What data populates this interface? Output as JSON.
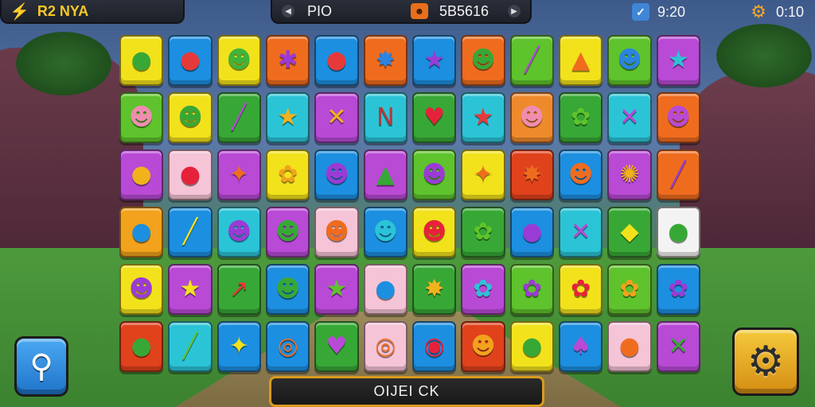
{
  "hud": {
    "left_label": "R2 NYA",
    "center_label": "PIO",
    "center_value": "5B5616",
    "timer_1": "9:20",
    "timer_2": "0:10"
  },
  "icons": {
    "bolt": "lightning-icon",
    "arrow": "arrow-left-icon",
    "tile_badge": "face-tile-icon",
    "check": "check-icon",
    "settings": "gear-icon",
    "hint": "magnifier-icon",
    "pause": "gear-icon"
  },
  "board": {
    "rows": [
      [
        {
          "color": "#f2e21c",
          "sym": "●",
          "fg": "#37a836"
        },
        {
          "color": "#1c8fe0",
          "sym": "●",
          "fg": "#e63a3a"
        },
        {
          "color": "#f2e21c",
          "sym": "☻",
          "fg": "#3fb33a"
        },
        {
          "color": "#ef6c1f",
          "sym": "✱",
          "fg": "#9b3bd6"
        },
        {
          "color": "#1c8fe0",
          "sym": "●",
          "fg": "#e63a3a"
        },
        {
          "color": "#ef6c1f",
          "sym": "✸",
          "fg": "#2b84e0"
        },
        {
          "color": "#1c8fe0",
          "sym": "★",
          "fg": "#9b3bd6"
        },
        {
          "color": "#ef6c1f",
          "sym": "☻",
          "fg": "#37a836"
        },
        {
          "color": "#5ec32c",
          "sym": "╱",
          "fg": "#b24ad6"
        },
        {
          "color": "#f2e21c",
          "sym": "▲",
          "fg": "#ef6c1f"
        },
        {
          "color": "#5ec32c",
          "sym": "☻",
          "fg": "#2b84e0"
        },
        {
          "color": "#b84ad6",
          "sym": "★",
          "fg": "#2bc4d6"
        }
      ],
      [
        {
          "color": "#5ec32c",
          "sym": "☻",
          "fg": "#f08cb0"
        },
        {
          "color": "#f2e21c",
          "sym": "☻",
          "fg": "#37a836"
        },
        {
          "color": "#37a836",
          "sym": "╱",
          "fg": "#b84ad6"
        },
        {
          "color": "#2bc4d6",
          "sym": "★",
          "fg": "#f2b21c"
        },
        {
          "color": "#b84ad6",
          "sym": "✕",
          "fg": "#f2b21c"
        },
        {
          "color": "#2bc4d6",
          "sym": "N",
          "fg": "#b23a3a"
        },
        {
          "color": "#37a836",
          "sym": "♥",
          "fg": "#e6223a"
        },
        {
          "color": "#2bc4d6",
          "sym": "★",
          "fg": "#e63a3a"
        },
        {
          "color": "#ef8a2c",
          "sym": "☻",
          "fg": "#f08cb0"
        },
        {
          "color": "#37a836",
          "sym": "✿",
          "fg": "#5ec32c"
        },
        {
          "color": "#2bc4d6",
          "sym": "✕",
          "fg": "#b84ad6"
        },
        {
          "color": "#ef6c1f",
          "sym": "☻",
          "fg": "#b84ad6"
        }
      ],
      [
        {
          "color": "#b84ad6",
          "sym": "●",
          "fg": "#f2b21c"
        },
        {
          "color": "#f5c4d6",
          "sym": "●",
          "fg": "#e6223a"
        },
        {
          "color": "#b84ad6",
          "sym": "✦",
          "fg": "#ef6c1f"
        },
        {
          "color": "#f2e21c",
          "sym": "✿",
          "fg": "#f2a21c"
        },
        {
          "color": "#1c8fe0",
          "sym": "☻",
          "fg": "#9b3bd6"
        },
        {
          "color": "#b84ad6",
          "sym": "▲",
          "fg": "#37a836"
        },
        {
          "color": "#5ec32c",
          "sym": "☻",
          "fg": "#9b3bd6"
        },
        {
          "color": "#f2e21c",
          "sym": "✦",
          "fg": "#ef6c1f"
        },
        {
          "color": "#e0421c",
          "sym": "✸",
          "fg": "#ef6c1f"
        },
        {
          "color": "#1c8fe0",
          "sym": "☻",
          "fg": "#ef6c1f"
        },
        {
          "color": "#b84ad6",
          "sym": "✺",
          "fg": "#f2b21c"
        },
        {
          "color": "#ef6c1f",
          "sym": "╱",
          "fg": "#9b3bd6"
        }
      ],
      [
        {
          "color": "#f2a21c",
          "sym": "●",
          "fg": "#1c8fe0"
        },
        {
          "color": "#1c8fe0",
          "sym": "╱",
          "fg": "#f2e21c"
        },
        {
          "color": "#2bc4d6",
          "sym": "☻",
          "fg": "#9b3bd6"
        },
        {
          "color": "#b84ad6",
          "sym": "☻",
          "fg": "#37a836"
        },
        {
          "color": "#f5c4d6",
          "sym": "☻",
          "fg": "#ef6c1f"
        },
        {
          "color": "#1c8fe0",
          "sym": "☻",
          "fg": "#2bc4d6"
        },
        {
          "color": "#f2e21c",
          "sym": "☻",
          "fg": "#e6223a"
        },
        {
          "color": "#37a836",
          "sym": "✿",
          "fg": "#5ec32c"
        },
        {
          "color": "#1c8fe0",
          "sym": "●",
          "fg": "#9b3bd6"
        },
        {
          "color": "#2bc4d6",
          "sym": "✕",
          "fg": "#b84ad6"
        },
        {
          "color": "#37a836",
          "sym": "◆",
          "fg": "#f2e21c"
        },
        {
          "color": "#f3f3f3",
          "sym": "●",
          "fg": "#37a836"
        }
      ],
      [
        {
          "color": "#f2e21c",
          "sym": "☻",
          "fg": "#9b3bd6"
        },
        {
          "color": "#b84ad6",
          "sym": "★",
          "fg": "#f2e21c"
        },
        {
          "color": "#37a836",
          "sym": "↗",
          "fg": "#e63a3a"
        },
        {
          "color": "#1c8fe0",
          "sym": "☻",
          "fg": "#37a836"
        },
        {
          "color": "#b84ad6",
          "sym": "★",
          "fg": "#5ec32c"
        },
        {
          "color": "#f5c4d6",
          "sym": "●",
          "fg": "#1c8fe0"
        },
        {
          "color": "#37a836",
          "sym": "✸",
          "fg": "#f2b21c"
        },
        {
          "color": "#b84ad6",
          "sym": "✿",
          "fg": "#2bc4d6"
        },
        {
          "color": "#5ec32c",
          "sym": "✿",
          "fg": "#9b3bd6"
        },
        {
          "color": "#f2e21c",
          "sym": "✿",
          "fg": "#e6223a"
        },
        {
          "color": "#5ec32c",
          "sym": "✿",
          "fg": "#f2a21c"
        },
        {
          "color": "#1c8fe0",
          "sym": "✿",
          "fg": "#9b3bd6"
        }
      ],
      [
        {
          "color": "#e0421c",
          "sym": "●",
          "fg": "#37a836"
        },
        {
          "color": "#2bc4d6",
          "sym": "╱",
          "fg": "#5ec32c"
        },
        {
          "color": "#1c8fe0",
          "sym": "✦",
          "fg": "#f2e21c"
        },
        {
          "color": "#1c8fe0",
          "sym": "◎",
          "fg": "#ef6c1f"
        },
        {
          "color": "#37a836",
          "sym": "♥",
          "fg": "#b84ad6"
        },
        {
          "color": "#f5c4d6",
          "sym": "◎",
          "fg": "#ef6c1f"
        },
        {
          "color": "#1c8fe0",
          "sym": "◉",
          "fg": "#e6223a"
        },
        {
          "color": "#e0421c",
          "sym": "☻",
          "fg": "#f2a21c"
        },
        {
          "color": "#f2e21c",
          "sym": "●",
          "fg": "#37a836"
        },
        {
          "color": "#1c8fe0",
          "sym": "♠",
          "fg": "#b84ad6"
        },
        {
          "color": "#f5c4d6",
          "sym": "●",
          "fg": "#ef6c1f"
        },
        {
          "color": "#b84ad6",
          "sym": "✕",
          "fg": "#37a836"
        }
      ]
    ]
  },
  "bottom_bar": {
    "label": "OIJEI CK"
  }
}
